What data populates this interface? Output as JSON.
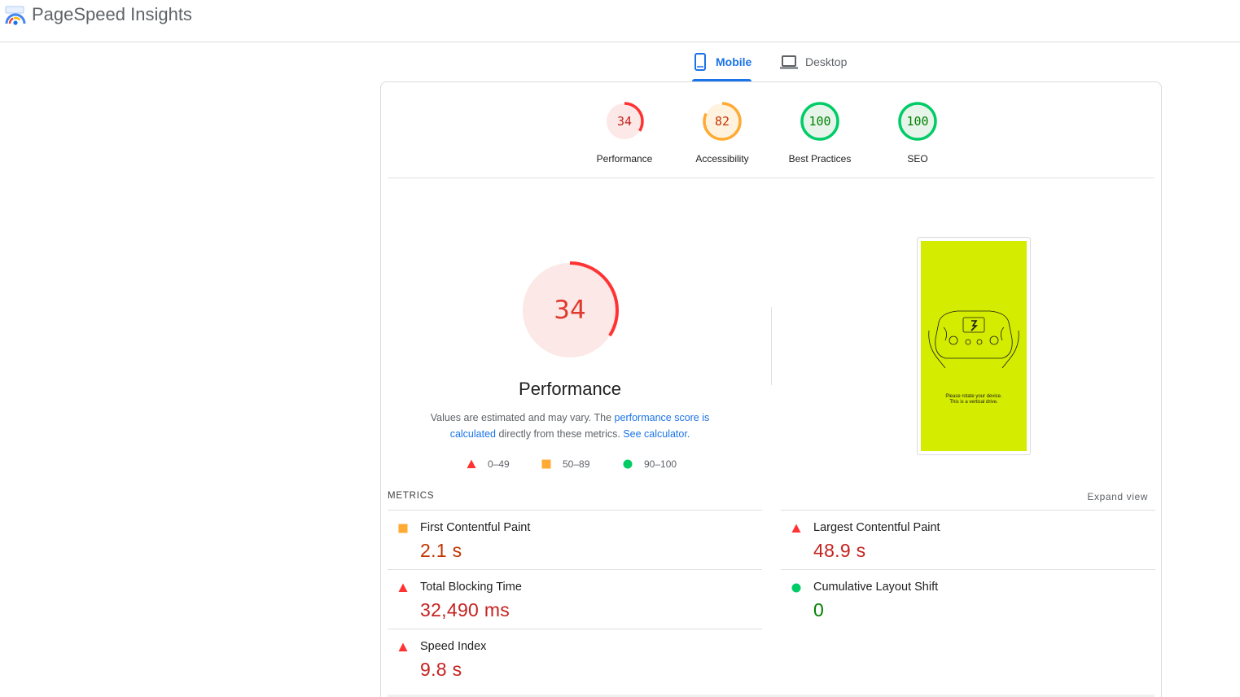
{
  "app": {
    "title": "PageSpeed Insights"
  },
  "tabs": [
    {
      "label": "Mobile",
      "icon": "phone-icon",
      "active": true
    },
    {
      "label": "Desktop",
      "icon": "laptop-icon",
      "active": false
    }
  ],
  "categories": [
    {
      "label": "Performance",
      "score": "34",
      "fraction": 0.34,
      "color": "#f33",
      "textColor": "#c5221f",
      "bg": "#fce8e6"
    },
    {
      "label": "Accessibility",
      "score": "82",
      "fraction": 0.82,
      "color": "#fa3",
      "textColor": "#c33300",
      "bg": "#fff3e0"
    },
    {
      "label": "Best Practices",
      "score": "100",
      "fraction": 1.0,
      "color": "#0c6",
      "textColor": "#008000",
      "bg": "#e6f4ea"
    },
    {
      "label": "SEO",
      "score": "100",
      "fraction": 1.0,
      "color": "#0c6",
      "textColor": "#008000",
      "bg": "#e6f4ea"
    }
  ],
  "performance": {
    "score": "34",
    "fraction": 0.34,
    "title": "Performance",
    "desc_before": "Values are estimated and may vary. The ",
    "desc_link1": "performance score is calculated",
    "desc_middle": " directly from these metrics. ",
    "desc_link2": "See calculator."
  },
  "legend": [
    {
      "shape": "triangle",
      "range": "0–49",
      "color": "#f33"
    },
    {
      "shape": "square",
      "range": "50–89",
      "color": "#fa3"
    },
    {
      "shape": "circle",
      "range": "90–100",
      "color": "#0c6"
    }
  ],
  "screenshot": {
    "text_line1": "Please rotate your device.",
    "text_line2": "This is a vertical drive.",
    "bg_color": "#d4ec00"
  },
  "metrics": {
    "header": "METRICS",
    "expand_label": "Expand view",
    "items": [
      {
        "name": "First Contentful Paint",
        "value": "2.1 s",
        "rating": "average"
      },
      {
        "name": "Largest Contentful Paint",
        "value": "48.9 s",
        "rating": "fail"
      },
      {
        "name": "Total Blocking Time",
        "value": "32,490 ms",
        "rating": "fail"
      },
      {
        "name": "Cumulative Layout Shift",
        "value": "0",
        "rating": "pass"
      },
      {
        "name": "Speed Index",
        "value": "9.8 s",
        "rating": "fail"
      }
    ]
  },
  "colors": {
    "accent": "#1a73e8",
    "fail": "#f33",
    "average": "#fa3",
    "pass": "#0c6",
    "fail_text": "#c5221f",
    "average_text": "#c33300",
    "pass_text": "#008000"
  }
}
